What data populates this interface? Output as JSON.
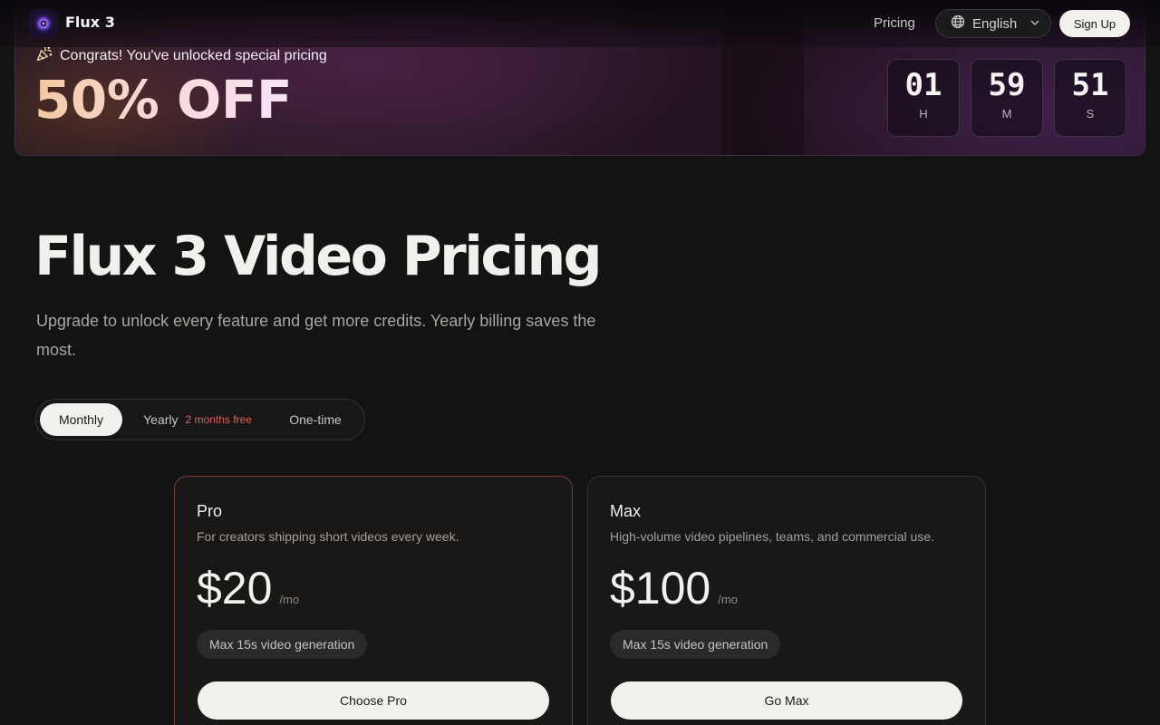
{
  "nav": {
    "brand": "Flux 3",
    "links": {
      "pricing": "Pricing"
    },
    "language": "English",
    "signup": "Sign Up"
  },
  "promo": {
    "message": "Congrats! You've unlocked special pricing",
    "discount": "50% OFF",
    "countdown": [
      {
        "value": "01",
        "unit": "H"
      },
      {
        "value": "59",
        "unit": "M"
      },
      {
        "value": "51",
        "unit": "S"
      }
    ]
  },
  "hero": {
    "title": "Flux 3 Video Pricing",
    "subtitle": "Upgrade to unlock every feature and get more credits. Yearly billing saves the most."
  },
  "billing": {
    "selected": "Monthly",
    "options": {
      "monthly": "Monthly",
      "yearly": "Yearly",
      "yearly_badge": "2 months free",
      "onetime": "One-time"
    }
  },
  "plans": [
    {
      "name": "Pro",
      "description": "For creators shipping short videos every week.",
      "price": "$20",
      "period": "/mo",
      "feature": "Max 15s video generation",
      "cta": "Choose Pro"
    },
    {
      "name": "Max",
      "description": "High-volume video pipelines, teams, and commercial use.",
      "price": "$100",
      "period": "/mo",
      "feature": "Max 15s video generation",
      "cta": "Go Max"
    }
  ],
  "colors": {
    "background": "#131313",
    "accent_red": "#d9645f",
    "button_light": "#f1f0ec",
    "logo_purple": "#9a6cff"
  },
  "icons": {
    "logo": "camera-lens-icon",
    "promo": "party-popper-icon",
    "language": "globe-icon",
    "dropdown": "chevron-down-icon"
  }
}
